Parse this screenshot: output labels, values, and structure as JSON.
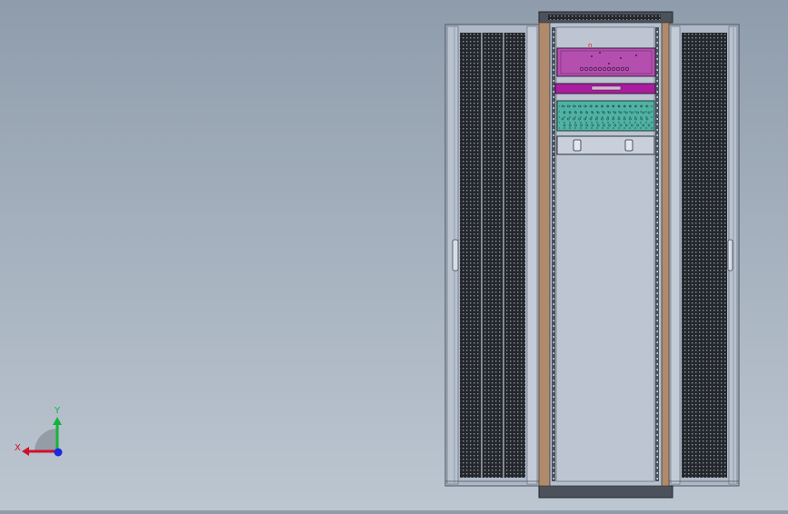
{
  "viewport": {
    "title": ""
  },
  "triad": {
    "x_label": "X",
    "y_label": "Y",
    "x_color": "#d0102a",
    "y_color": "#14b43c",
    "z_color": "#1a2ae0"
  },
  "model": {
    "frame_color": "#b08a6c",
    "door_perforation_color": "#1e2126",
    "module_top_color": "#b44fb0",
    "module_bar_color": "#a81e9e",
    "module_connector_color": "#4fb2a4",
    "module_bottom_color": "#c9cfdb",
    "top_marker": "n"
  }
}
